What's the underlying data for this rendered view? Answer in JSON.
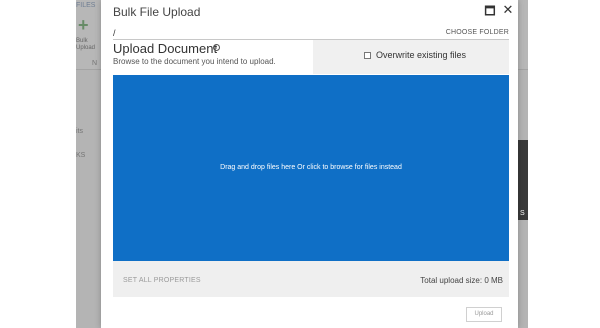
{
  "background_app": {
    "tab_label": "FILES",
    "upload_button_label": "Bulk Upload",
    "nav_items": [
      "N",
      "its",
      "KS"
    ],
    "thumb_letter": "S"
  },
  "dialog": {
    "title": "Bulk File Upload",
    "maximize_glyph": "🗖",
    "close_glyph": "✕",
    "path": "/",
    "choose_folder": "CHOOSE FOLDER",
    "upload_document": {
      "title": "Upload Document",
      "info_glyph": "i",
      "subtitle": "Browse to the document you intend to upload."
    },
    "overwrite_label": "Overwrite existing files",
    "overwrite_checked": false,
    "drop_zone_text": "Drag and drop files here Or click to browse for files instead",
    "drop_zone_color": "#0f6fc6",
    "set_all_properties": "SET ALL PROPERTIES",
    "total_upload_size": "Total upload size: 0 MB",
    "upload_button": "Upload"
  }
}
